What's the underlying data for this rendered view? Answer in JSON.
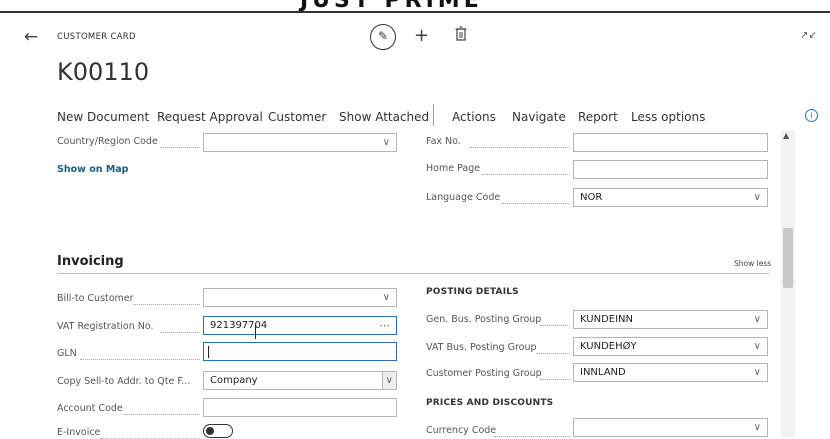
{
  "banner": "JUST PRIME",
  "header": {
    "caption": "CUSTOMER CARD",
    "title": "K00110"
  },
  "action_bar": {
    "items": [
      "New Document",
      "Request Approval",
      "Customer",
      "Show Attached",
      "Actions",
      "Navigate",
      "Report",
      "Less options"
    ]
  },
  "general": {
    "country_region_code": {
      "label": "Country/Region Code",
      "value": ""
    },
    "show_on_map": "Show on Map",
    "fax_no": {
      "label": "Fax No.",
      "value": ""
    },
    "home_page": {
      "label": "Home Page",
      "value": ""
    },
    "language_code": {
      "label": "Language Code",
      "value": "NOR"
    }
  },
  "invoicing": {
    "title": "Invoicing",
    "show_less": "Show less",
    "bill_to_customer": {
      "label": "Bill-to Customer",
      "value": ""
    },
    "vat_registration_no": {
      "label": "VAT Registration No.",
      "value": "921397704"
    },
    "gln": {
      "label": "GLN",
      "value": ""
    },
    "copy_sell_to": {
      "label": "Copy Sell-to Addr. to Qte F...",
      "value": "Company"
    },
    "account_code": {
      "label": "Account Code",
      "value": ""
    },
    "e_invoice": {
      "label": "E-Invoice"
    },
    "posting_details": {
      "title": "POSTING DETAILS",
      "gen_bus": {
        "label": "Gen. Bus. Posting Group",
        "value": "KUNDEINN"
      },
      "vat_bus": {
        "label": "VAT Bus. Posting Group",
        "value": "KUNDEHØY"
      },
      "customer_posting": {
        "label": "Customer Posting Group",
        "value": "INNLAND"
      }
    },
    "prices_discounts": {
      "title": "PRICES AND DISCOUNTS",
      "currency_code": {
        "label": "Currency Code",
        "value": ""
      }
    }
  },
  "colors": {
    "link": "#1a5e86",
    "accent": "#2a6ebb"
  }
}
